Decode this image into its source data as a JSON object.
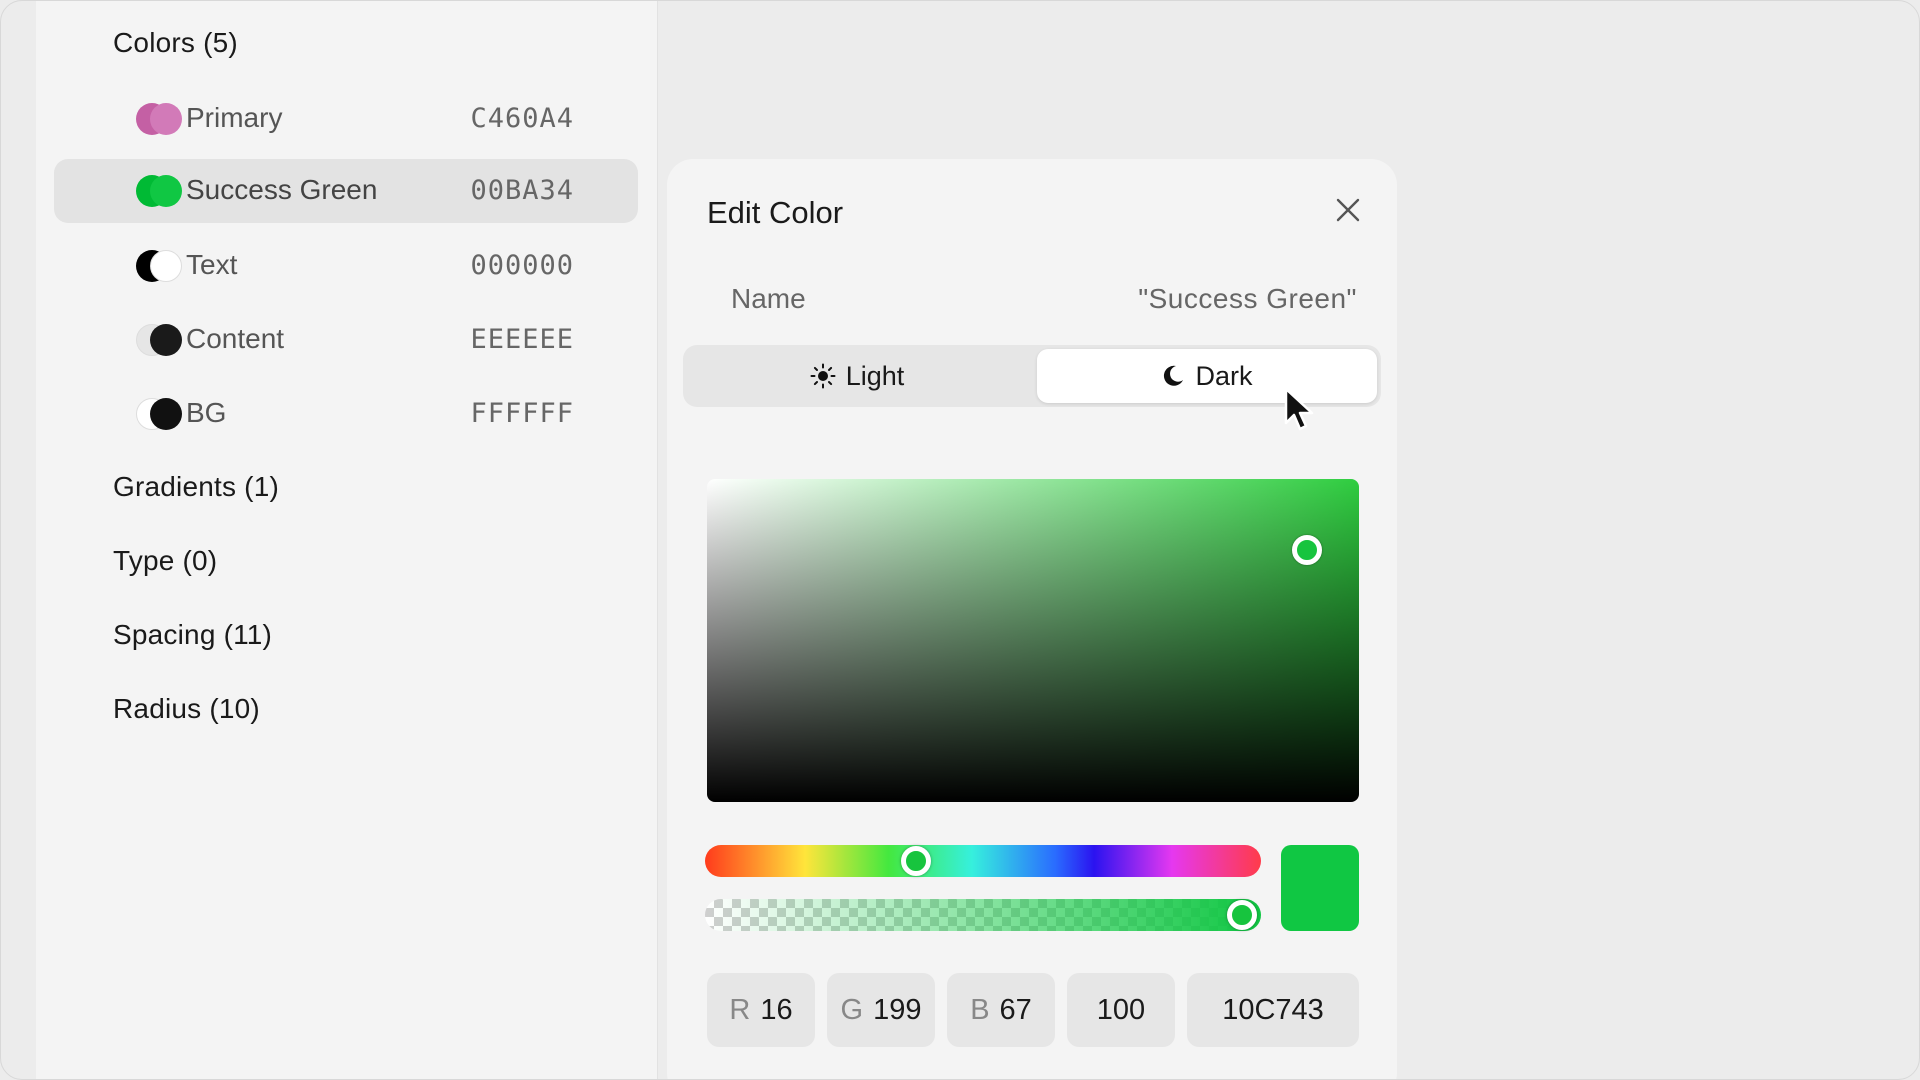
{
  "sidebar": {
    "sections": {
      "colors": "Colors (5)",
      "gradients": "Gradients (1)",
      "type": "Type (0)",
      "spacing": "Spacing (11)",
      "radius": "Radius (10)"
    },
    "colors": [
      {
        "name": "Primary",
        "hex": "C460A4",
        "swatch_light": "#c460a4",
        "swatch_dark": "#d27ab8",
        "selected": false
      },
      {
        "name": "Success Green",
        "hex": "00BA34",
        "swatch_light": "#00ba34",
        "swatch_dark": "#10c743",
        "selected": true
      },
      {
        "name": "Text",
        "hex": "000000",
        "swatch_light": "#000000",
        "swatch_dark": "#ffffff",
        "selected": false
      },
      {
        "name": "Content",
        "hex": "EEEEEE",
        "swatch_light": "#eeeeee",
        "swatch_dark": "#1a1a1a",
        "selected": false
      },
      {
        "name": "BG",
        "hex": "FFFFFF",
        "swatch_light": "#ffffff",
        "swatch_dark": "#111111",
        "selected": false
      }
    ]
  },
  "panel": {
    "title": "Edit Color",
    "name_label": "Name",
    "name_value": "\"Success Green\"",
    "mode_light": "Light",
    "mode_dark": "Dark",
    "active_mode": "Dark",
    "preview_color": "#10c743",
    "hue_position": 0.38,
    "alpha_position": 1.0,
    "picker": {
      "saturation": 0.92,
      "brightness": 0.78
    },
    "fields": {
      "r_label": "R",
      "r_value": "16",
      "g_label": "G",
      "g_value": "199",
      "b_label": "B",
      "b_value": "67",
      "alpha_value": "100",
      "hex_value": "10C743"
    }
  },
  "icons": {
    "close": "close-icon",
    "sun": "sun-icon",
    "moon": "moon-icon",
    "cursor": "cursor-icon"
  }
}
